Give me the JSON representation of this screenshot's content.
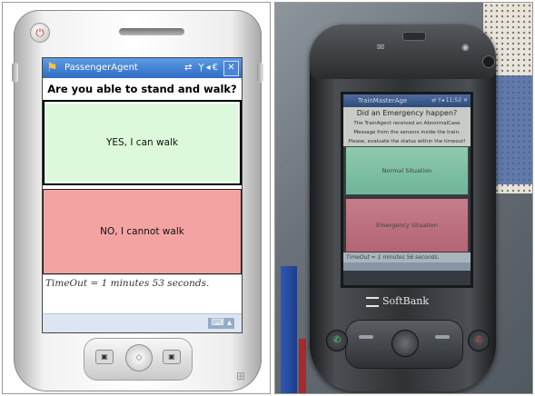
{
  "left_device": {
    "titlebar": {
      "app_title": "PassengerAgent",
      "tray_icons": "⇄ Ỵ◂€",
      "close_label": "✕"
    },
    "question": "Are you able to stand and walk?",
    "yes_label": "YES, I can walk",
    "no_label": "NO, I cannot walk",
    "timeout_text": "TimeOut = 1 minutes 53 seconds.",
    "keyboard_icon": "⌨ ▴",
    "hw_left_key": "▣",
    "hw_right_key": "▣",
    "dpad_glyph": "◇",
    "windows_logo": "⊞"
  },
  "right_device": {
    "titlebar": {
      "app_title": "TrainMasterAge",
      "tray_icons": "⇄ Ỵ◂ 11:52 ✕"
    },
    "question": "Did an Emergency happen?",
    "message_lines": [
      "The TrainAgent received an AbnormalCase",
      "Message from the sensors inside the train.",
      "Please, evaluate the status within the timeout!"
    ],
    "normal_label": "Normal Situation",
    "emergency_label": "Emergency Situation",
    "timeout_text": "TimeOut = 1 minutes 56 seconds.",
    "brand": "SoftBank"
  },
  "colors": {
    "yes_bg": "#dcf9dc",
    "no_bg": "#f4a3a3",
    "titlebar": "#3a78cf",
    "photo_normal": "#7fbfa4",
    "photo_emergency": "#bc7180"
  },
  "icons": [
    "power-icon",
    "windows-flag-icon",
    "signal-icon",
    "speaker-icon",
    "close-icon",
    "keyboard-icon",
    "dpad-icon",
    "mail-icon",
    "globe-icon",
    "call-green-icon",
    "call-red-icon"
  ]
}
